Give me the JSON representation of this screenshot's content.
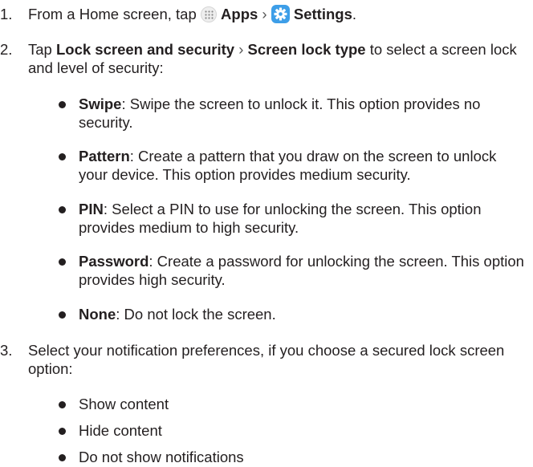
{
  "steps": [
    {
      "number": "1.",
      "parts": {
        "a": "From a Home screen, tap ",
        "apps": "Apps",
        "sep": " › ",
        "settings": "Settings",
        "end": "."
      },
      "icons": [
        "apps-grid-icon",
        "settings-gear-icon"
      ]
    },
    {
      "number": "2.",
      "parts": {
        "a": "Tap ",
        "lock_screen": "Lock screen and security",
        "sep": " › ",
        "lock_type": "Screen lock type",
        "rest": " to select a screen lock and level of security:"
      },
      "bullets": [
        {
          "term": "Swipe",
          "desc": ": Swipe the screen to unlock it. This option provides no security."
        },
        {
          "term": "Pattern",
          "desc": ": Create a pattern that you draw on the screen to unlock your device. This option provides medium security."
        },
        {
          "term": "PIN",
          "desc": ": Select a PIN to use for unlocking the screen. This option provides medium to high security."
        },
        {
          "term": "Password",
          "desc": ": Create a password for unlocking the screen. This option provides high security."
        },
        {
          "term": "None",
          "desc": ": Do not lock the screen."
        }
      ]
    },
    {
      "number": "3.",
      "text": "Select your notification preferences, if you choose a secured lock screen option:",
      "bullets": [
        {
          "text": "Show content"
        },
        {
          "text": "Hide content"
        },
        {
          "text": "Do not show notifications"
        }
      ]
    }
  ]
}
